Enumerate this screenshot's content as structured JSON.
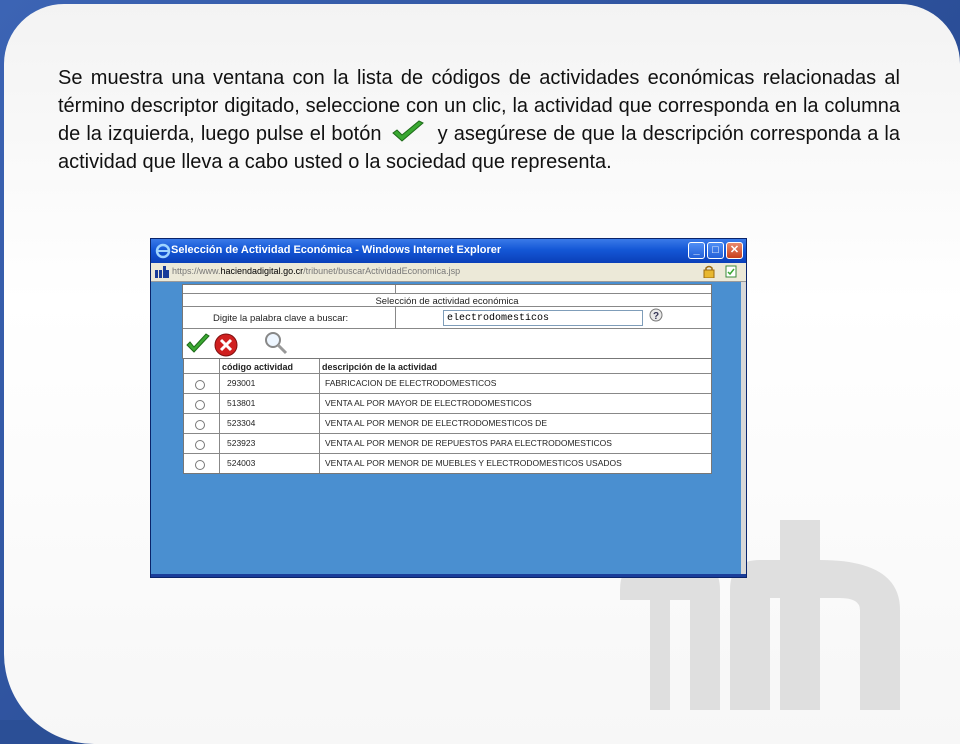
{
  "instruction": {
    "part1": "Se muestra una ventana con la lista de códigos de actividades económicas relacionadas al término descriptor digitado, seleccione con un clic, la actividad que corresponda en la columna de la izquierda, luego pulse el botón",
    "part2": "y asegúrese de que la descripción corresponda a la actividad que lleva a cabo usted o la sociedad que representa.",
    "inline_icon": "green-check-icon"
  },
  "window": {
    "title": "Selección de Actividad Económica - Windows Internet Explorer",
    "url_prefix": "https://www.",
    "url_host": "haciendadigital.go.cr",
    "url_path": "/tribunet/buscarActividadEconomica.jsp"
  },
  "form": {
    "header": "Selección de actividad económica",
    "search_label": "Digite la palabra clave a buscar:",
    "search_value": "electrodomesticos",
    "help_icon": "help-icon",
    "actions": [
      "accept-check-icon",
      "cancel-x-icon",
      "magnifier-icon"
    ]
  },
  "table": {
    "headers": [
      "código actividad",
      "descripción de la actividad"
    ],
    "rows": [
      {
        "code": "293001",
        "description": "FABRICACION DE ELECTRODOMESTICOS"
      },
      {
        "code": "513801",
        "description": "VENTA AL POR MAYOR DE ELECTRODOMESTICOS"
      },
      {
        "code": "523304",
        "description": "VENTA AL POR MENOR DE ELECTRODOMESTICOS DE"
      },
      {
        "code": "523923",
        "description": "VENTA AL POR MENOR DE REPUESTOS PARA ELECTRODOMESTICOS"
      },
      {
        "code": "524003",
        "description": "VENTA AL POR MENOR DE MUEBLES Y ELECTRODOMESTICOS USADOS"
      }
    ]
  },
  "colors": {
    "accent_blue": "#4a8fd0",
    "titlebar_blue": "#1457d6",
    "check_green": "#3aa832",
    "cancel_red": "#d02020"
  }
}
